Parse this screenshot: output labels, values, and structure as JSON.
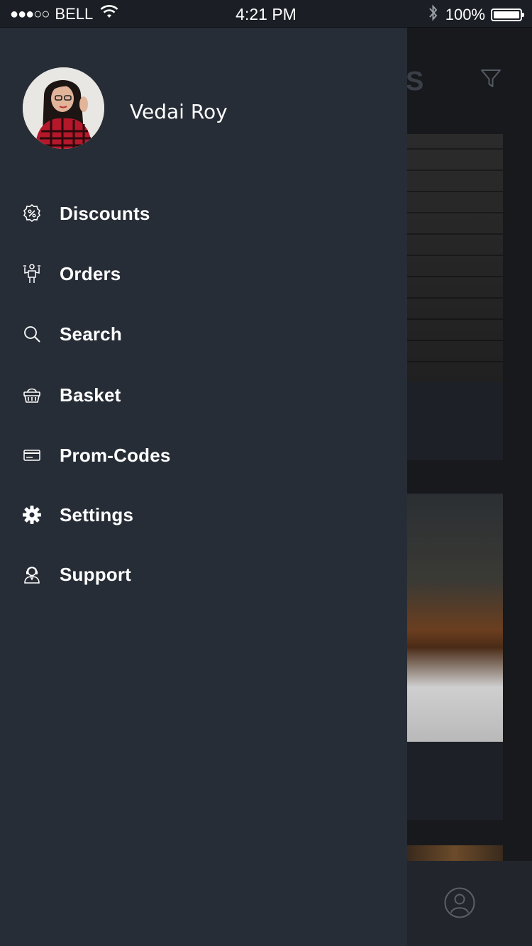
{
  "status_bar": {
    "signal_dots": "●●●○○",
    "carrier": "BELL",
    "time": "4:21 PM",
    "battery_text": "100%",
    "battery_level": 1.0,
    "icons": [
      "wifi-icon",
      "bluetooth-icon",
      "battery-icon"
    ]
  },
  "background_screen": {
    "header_letter": "S",
    "icons": [
      "filter-icon",
      "profile-icon"
    ]
  },
  "drawer": {
    "user": {
      "name": "Vedai Roy",
      "avatar": "avatar-photo"
    },
    "menu": [
      {
        "label": "Discounts",
        "icon": "discount-icon"
      },
      {
        "label": "Orders",
        "icon": "orders-icon"
      },
      {
        "label": "Search",
        "icon": "search-icon"
      },
      {
        "label": "Basket",
        "icon": "basket-icon"
      },
      {
        "label": "Prom-Codes",
        "icon": "card-icon"
      },
      {
        "label": "Settings",
        "icon": "gear-icon"
      },
      {
        "label": "Support",
        "icon": "support-icon"
      }
    ]
  },
  "colors": {
    "drawer_bg": "#272d36",
    "status_bar_bg": "#1b1f25",
    "text": "#ffffff"
  }
}
